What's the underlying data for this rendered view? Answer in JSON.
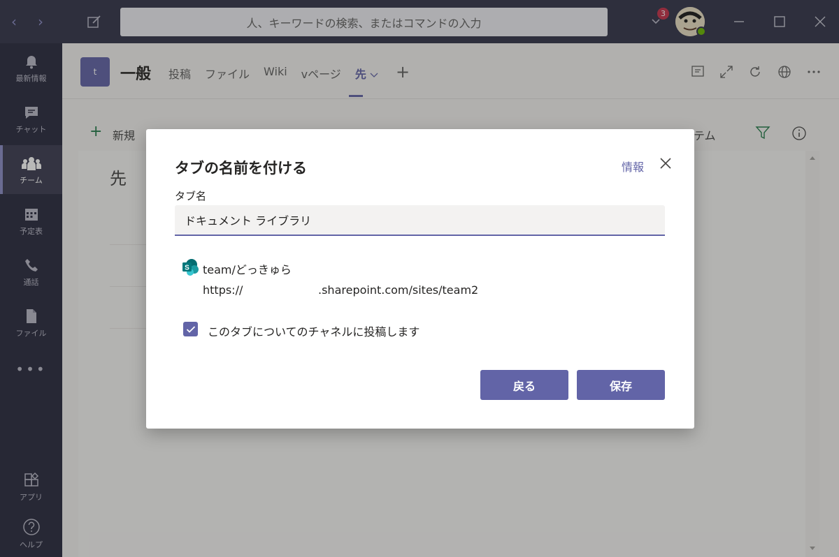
{
  "titlebar": {
    "search_placeholder": "人、キーワードの検索、またはコマンドの入力",
    "notification_count": "3"
  },
  "rail": {
    "items": [
      {
        "label": "最新情報",
        "icon": "bell-icon"
      },
      {
        "label": "チャット",
        "icon": "chat-icon"
      },
      {
        "label": "チーム",
        "icon": "teams-icon",
        "active": true
      },
      {
        "label": "予定表",
        "icon": "calendar-icon"
      },
      {
        "label": "通話",
        "icon": "phone-icon"
      },
      {
        "label": "ファイル",
        "icon": "file-icon"
      },
      {
        "label": "アプリ",
        "icon": "apps-icon"
      },
      {
        "label": "ヘルプ",
        "icon": "help-icon"
      }
    ],
    "more": "•••"
  },
  "header": {
    "team_initial": "t",
    "channel_name": "一般",
    "tabs": [
      "投稿",
      "ファイル",
      "Wiki",
      "vページ",
      "先"
    ]
  },
  "commandbar": {
    "new_label": "新規",
    "right_label": "テム"
  },
  "document": {
    "title": "先"
  },
  "dialog": {
    "title": "タブの名前を付ける",
    "info_link": "情報",
    "field_label": "タブ名",
    "tab_name_value": "ドキュメント ライブラリ",
    "site_name": "team/どっきゅら",
    "site_url_prefix": "https://",
    "site_url_suffix": ".sharepoint.com/sites/team2",
    "post_to_channel_label": "このタブについてのチャネルに投稿します",
    "post_to_channel_checked": true,
    "back_button": "戻る",
    "save_button": "保存"
  },
  "colors": {
    "brand": "#6264a7",
    "titlebar": "#33344a",
    "rail": "#292a3e",
    "sharepoint": "#038387"
  }
}
